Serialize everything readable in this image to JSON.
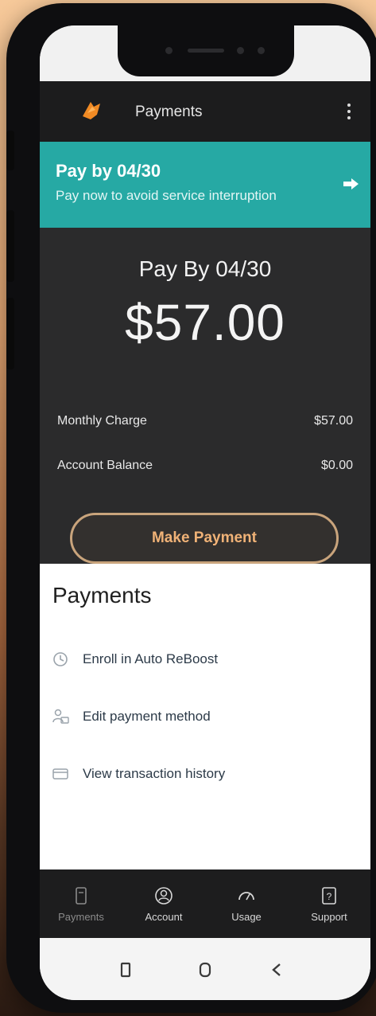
{
  "header": {
    "title": "Payments"
  },
  "banner": {
    "title": "Pay by 04/30",
    "subtitle": "Pay now to avoid service interruption"
  },
  "summary": {
    "due_label": "Pay By 04/30",
    "due_amount": "$57.00",
    "rows": [
      {
        "label": "Monthly Charge",
        "value": "$57.00"
      },
      {
        "label": "Account Balance",
        "value": "$0.00"
      }
    ],
    "pay_button": "Make Payment"
  },
  "payments": {
    "title": "Payments",
    "items": [
      {
        "label": "Enroll in Auto ReBoost",
        "icon": "sync-icon"
      },
      {
        "label": "Edit payment method",
        "icon": "card-user-icon"
      },
      {
        "label": "View transaction history",
        "icon": "history-card-icon"
      }
    ]
  },
  "bottom_nav": {
    "items": [
      {
        "label": "Payments",
        "icon": "payments-icon"
      },
      {
        "label": "Account",
        "icon": "account-icon"
      },
      {
        "label": "Usage",
        "icon": "usage-icon"
      },
      {
        "label": "Support",
        "icon": "support-icon"
      }
    ]
  },
  "colors": {
    "accent_teal": "#26a9a4",
    "accent_orange": "#f0b277",
    "panel_dark": "#2b2b2c"
  }
}
